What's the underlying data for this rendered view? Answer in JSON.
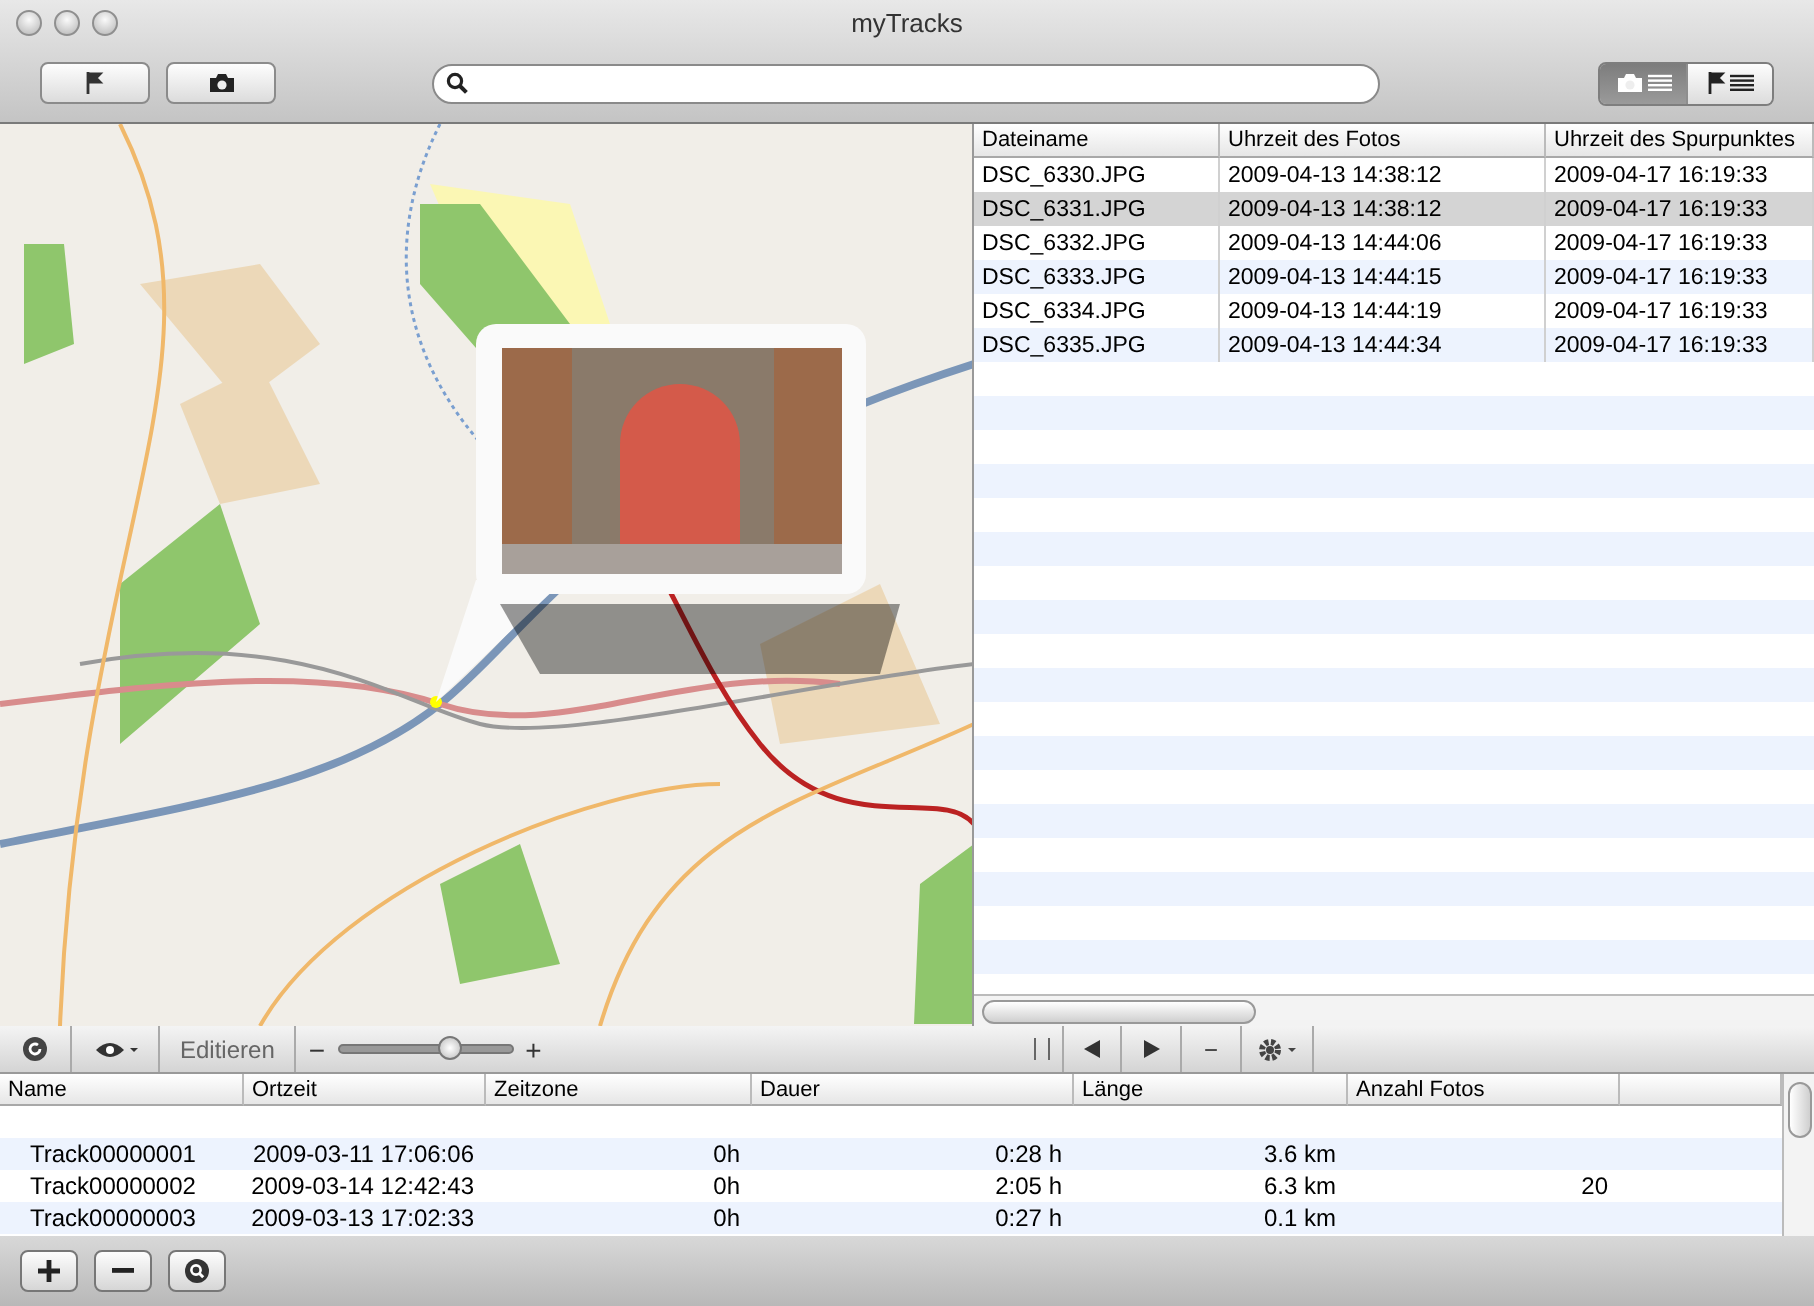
{
  "window": {
    "title": "myTracks"
  },
  "toolbar": {
    "view_segments": [
      {
        "kind": "photos",
        "selected": true
      },
      {
        "kind": "tracks",
        "selected": false
      }
    ]
  },
  "photos_table": {
    "columns": [
      "Dateiname",
      "Uhrzeit des Fotos",
      "Uhrzeit des Spurpunktes"
    ],
    "rows": [
      {
        "cells": [
          "DSC_6330.JPG",
          "2009-04-13 14:38:12",
          "2009-04-17 16:19:33"
        ],
        "selected": false
      },
      {
        "cells": [
          "DSC_6331.JPG",
          "2009-04-13 14:38:12",
          "2009-04-17 16:19:33"
        ],
        "selected": true
      },
      {
        "cells": [
          "DSC_6332.JPG",
          "2009-04-13 14:44:06",
          "2009-04-17 16:19:33"
        ],
        "selected": false
      },
      {
        "cells": [
          "DSC_6333.JPG",
          "2009-04-13 14:44:15",
          "2009-04-17 16:19:33"
        ],
        "selected": false
      },
      {
        "cells": [
          "DSC_6334.JPG",
          "2009-04-13 14:44:19",
          "2009-04-17 16:19:33"
        ],
        "selected": false
      },
      {
        "cells": [
          "DSC_6335.JPG",
          "2009-04-13 14:44:34",
          "2009-04-17 16:19:33"
        ],
        "selected": false
      }
    ]
  },
  "map_bar": {
    "edit_label": "Editieren",
    "zoom_minus": "−",
    "zoom_plus": "+",
    "zoom": {
      "level": 0.65
    },
    "remove": "−"
  },
  "tracks_table": {
    "columns": [
      "Name",
      "Ortzeit",
      "Zeitzone",
      "Dauer",
      "Länge",
      "Anzahl Fotos"
    ],
    "rows": [
      {
        "cells": [
          "Track00000001",
          "2009-03-11 17:06:06",
          "0h",
          "0:28 h",
          "3.6 km",
          ""
        ]
      },
      {
        "cells": [
          "Track00000002",
          "2009-03-14 12:42:43",
          "0h",
          "2:05 h",
          "6.3 km",
          "20"
        ]
      },
      {
        "cells": [
          "Track00000003",
          "2009-03-13 17:02:33",
          "0h",
          "0:27 h",
          "0.1 km",
          ""
        ]
      }
    ]
  }
}
